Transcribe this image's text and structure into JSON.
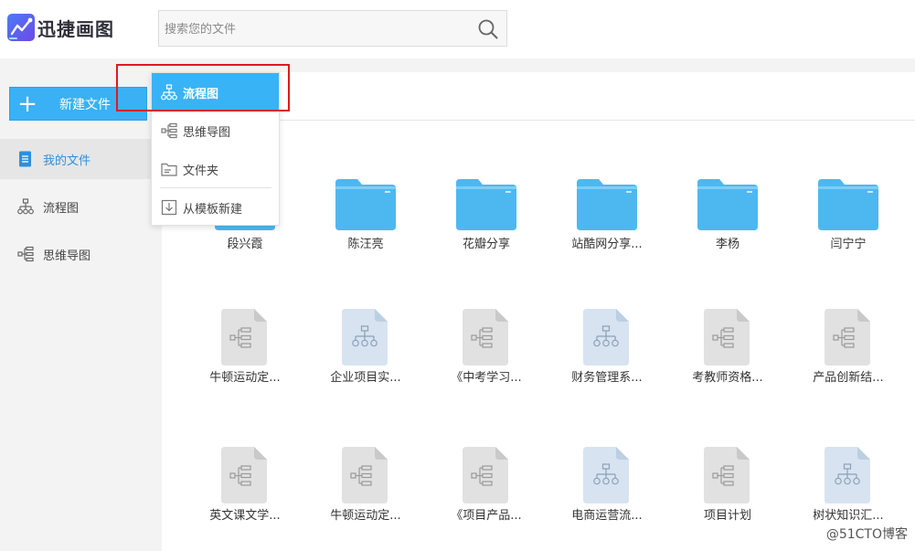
{
  "app": {
    "title": "迅捷画图"
  },
  "search": {
    "placeholder": "搜索您的文件",
    "value": ""
  },
  "sidebar": {
    "new_button_label": "新建文件",
    "items": [
      {
        "label": "我的文件",
        "icon": "document-icon",
        "active": true
      },
      {
        "label": "流程图",
        "icon": "flowchart-icon",
        "active": false
      },
      {
        "label": "思维导图",
        "icon": "mindmap-icon",
        "active": false
      }
    ]
  },
  "new_menu": {
    "items": [
      {
        "label": "流程图",
        "icon": "flowchart-icon",
        "selected": true
      },
      {
        "label": "思维导图",
        "icon": "mindmap-icon",
        "selected": false
      },
      {
        "label": "文件夹",
        "icon": "folder-outline-icon",
        "selected": false
      },
      {
        "label": "从模板新建",
        "icon": "template-import-icon",
        "selected": false
      }
    ]
  },
  "files": {
    "row1": [
      {
        "name": "段兴霞",
        "type": "folder"
      },
      {
        "name": "陈汪亮",
        "type": "folder"
      },
      {
        "name": "花瓣分享",
        "type": "folder"
      },
      {
        "name": "站酷网分享...",
        "type": "folder"
      },
      {
        "name": "李杨",
        "type": "folder"
      },
      {
        "name": "闫宁宁",
        "type": "folder"
      }
    ],
    "row2": [
      {
        "name": "牛顿运动定...",
        "type": "mindmap"
      },
      {
        "name": "企业项目实...",
        "type": "flowchart"
      },
      {
        "name": "《中考学习...",
        "type": "mindmap"
      },
      {
        "name": "财务管理系...",
        "type": "flowchart"
      },
      {
        "name": "考教师资格...",
        "type": "mindmap"
      },
      {
        "name": "产品创新结...",
        "type": "mindmap"
      }
    ],
    "row3": [
      {
        "name": "英文课文学...",
        "type": "mindmap"
      },
      {
        "name": "牛顿运动定...",
        "type": "mindmap"
      },
      {
        "name": "《项目产品...",
        "type": "mindmap"
      },
      {
        "name": "电商运营流...",
        "type": "flowchart"
      },
      {
        "name": "项目计划",
        "type": "mindmap"
      },
      {
        "name": "树状知识汇...",
        "type": "flowchart"
      }
    ]
  },
  "watermark": "@51CTO博客",
  "colors": {
    "accent": "#38b3f6",
    "folder": "#4db8f0",
    "highlight": "#e0191f"
  }
}
